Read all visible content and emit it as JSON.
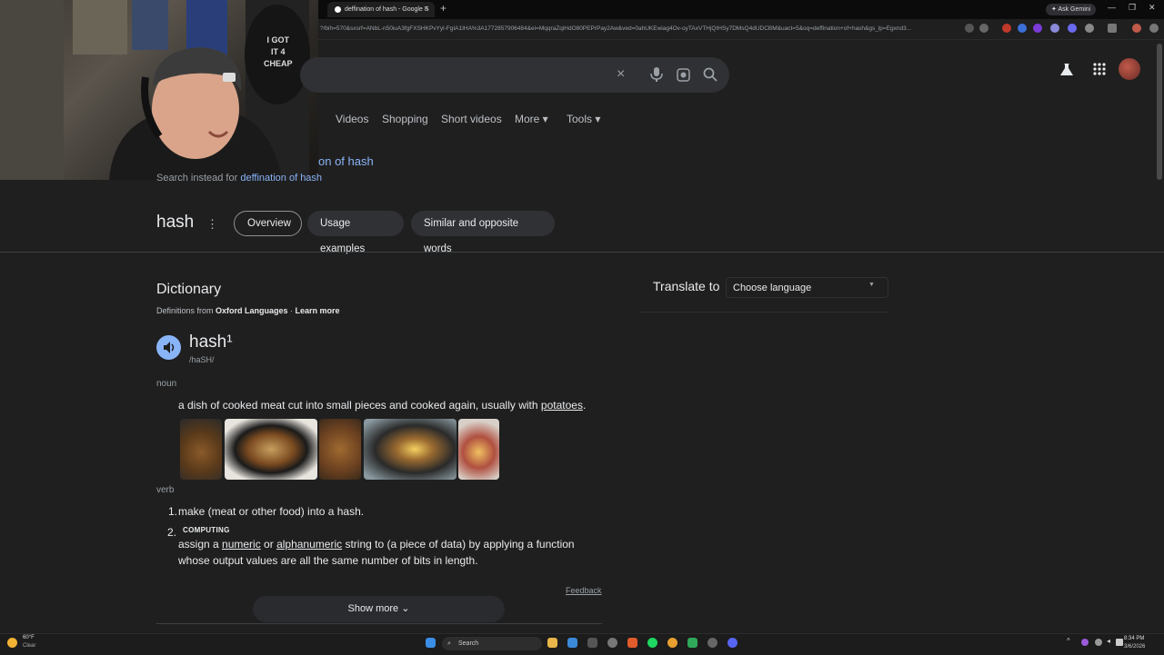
{
  "browser": {
    "tab_title": "deffination of hash - Google S",
    "tab_close": "×",
    "new_tab": "+",
    "ask_gemini": "Ask Gemini",
    "window_controls": [
      "—",
      "❐",
      "✕"
    ],
    "url": "?/bih=570&sxsrf=ANbL-n50iuA3fgFXSHKPvYyl-FgIA1IHA%3A1772857906484&ei=MqqraZqiHdO80PEPrPay2Aw&ved=0ahUKEwiag4Ov-oyTAxVTHjQIHSy7DMsQ4dUDCBM&uact=5&oq=deffination+of+hash&gs_lp=Egxnd3..."
  },
  "search": {
    "clear_icon": "×"
  },
  "nav_tabs": [
    "Videos",
    "Shopping",
    "Short videos",
    "More ▾",
    "Tools ▾"
  ],
  "correction": {
    "showing_prefix": "on of hash",
    "instead_prefix": "Search instead for ",
    "instead_link": "deffination of hash"
  },
  "term": {
    "word": "hash",
    "menu": "⋮",
    "chips": [
      "Overview",
      "Usage examples",
      "Similar and opposite words"
    ]
  },
  "dictionary": {
    "title": "Dictionary",
    "defs_from": "Definitions from ",
    "source": "Oxford Languages",
    "separator": " · ",
    "learn_more": "Learn more",
    "headword": "hash¹",
    "phonetic": "/haSH/",
    "noun_label": "noun",
    "noun_def_pre": "a dish of cooked meat cut into small pieces and cooked again, usually with ",
    "noun_def_link": "potatoes",
    "noun_def_end": ".",
    "verb_label": "verb",
    "verb_num_1": "1.",
    "verb_def_1": "make (meat or other food) into a hash.",
    "verb_num_2": "2.",
    "verb_tag_2": "COMPUTING",
    "verb_def_2a_pre": "assign a ",
    "verb_def_2a_link1": "numeric",
    "verb_def_2a_mid": " or ",
    "verb_def_2a_link2": "alphanumeric",
    "verb_def_2a_post": " string to (a piece of data) by applying a function",
    "verb_def_2b": "whose output values are all the same number of bits in length.",
    "feedback": "Feedback",
    "show_more": "Show more ⌄"
  },
  "translate": {
    "label": "Translate to",
    "select_value": "Choose language",
    "arrow": "▼"
  },
  "webcam_shirt_text": "I GOT\nIT 4\nCHEAP",
  "taskbar": {
    "weather_temp": "60°F",
    "weather_desc": "Clear",
    "search": "Search",
    "time": "8:34 PM",
    "date": "3/6/2026"
  },
  "colors": {
    "link": "#8ab4f8",
    "background": "#1f1f1f",
    "searchbox": "#303134"
  }
}
